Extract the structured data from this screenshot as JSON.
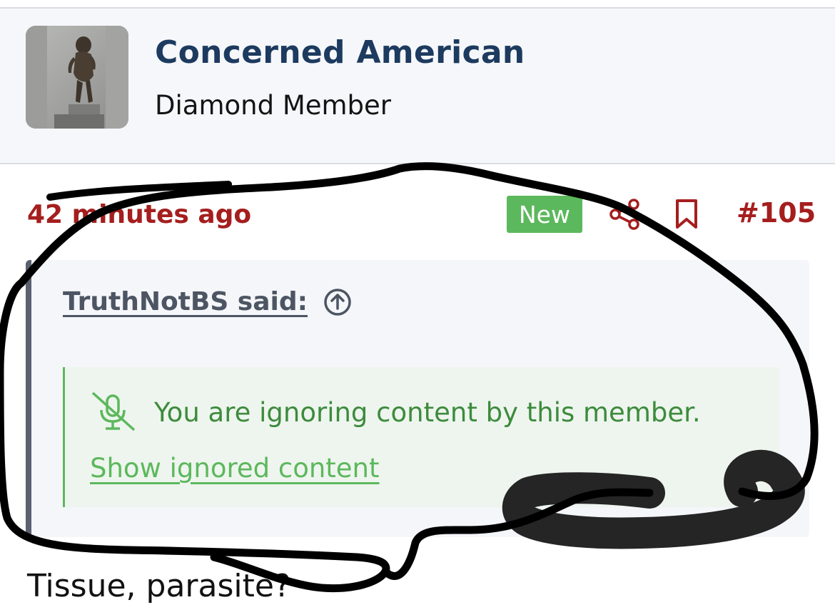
{
  "user": {
    "name": "Concerned American",
    "title": "Diamond Member"
  },
  "post": {
    "time_ago": "42 minutes ago",
    "badge": "New",
    "number": "#105",
    "body": "Tissue, parasite?"
  },
  "quote": {
    "author": "TruthNotBS said:",
    "ignored_message": "You are ignoring content by this member.",
    "show_link": "Show ignored content"
  },
  "icons": {
    "share": "share-icon",
    "bookmark": "bookmark-icon",
    "jump": "arrow-up-circle-icon",
    "ignored": "muted-microphone-icon"
  },
  "colors": {
    "username": "#1d3a5f",
    "meta_red": "#a51e1e",
    "badge_green": "#5cb85c",
    "ignored_text": "#3d8b3d",
    "quote_bar": "#5b6170"
  }
}
